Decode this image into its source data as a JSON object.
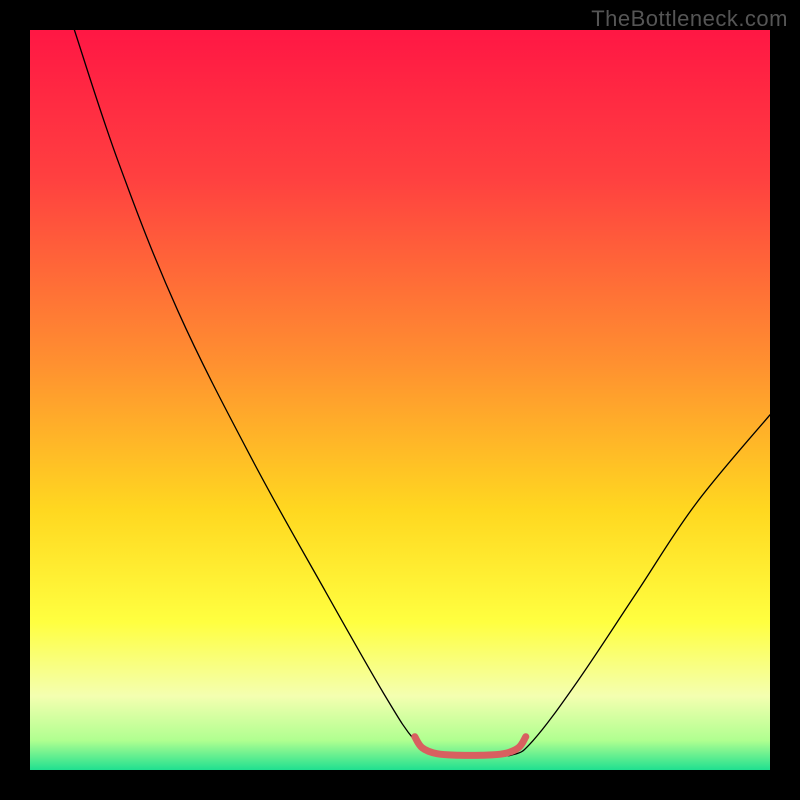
{
  "watermark": "TheBottleneck.com",
  "chart_data": {
    "type": "line",
    "title": "",
    "xlabel": "",
    "ylabel": "",
    "xlim": [
      0,
      100
    ],
    "ylim": [
      0,
      100
    ],
    "background_gradient": {
      "stops": [
        {
          "offset": 0.0,
          "color": "#ff1744"
        },
        {
          "offset": 0.2,
          "color": "#ff4040"
        },
        {
          "offset": 0.45,
          "color": "#ff9030"
        },
        {
          "offset": 0.65,
          "color": "#ffd820"
        },
        {
          "offset": 0.8,
          "color": "#ffff40"
        },
        {
          "offset": 0.9,
          "color": "#f4ffb0"
        },
        {
          "offset": 0.96,
          "color": "#b0ff90"
        },
        {
          "offset": 1.0,
          "color": "#20e090"
        }
      ]
    },
    "series": [
      {
        "name": "bottleneck-curve",
        "color": "#000000",
        "stroke_width": 1.3,
        "points": [
          {
            "x": 6,
            "y": 100
          },
          {
            "x": 12,
            "y": 82
          },
          {
            "x": 20,
            "y": 62
          },
          {
            "x": 30,
            "y": 42
          },
          {
            "x": 40,
            "y": 24
          },
          {
            "x": 48,
            "y": 10
          },
          {
            "x": 52,
            "y": 4
          },
          {
            "x": 55,
            "y": 2
          },
          {
            "x": 60,
            "y": 2
          },
          {
            "x": 65,
            "y": 2
          },
          {
            "x": 68,
            "y": 4
          },
          {
            "x": 74,
            "y": 12
          },
          {
            "x": 82,
            "y": 24
          },
          {
            "x": 90,
            "y": 36
          },
          {
            "x": 100,
            "y": 48
          }
        ]
      },
      {
        "name": "optimal-zone-marker",
        "color": "#d86060",
        "stroke_width": 7,
        "points": [
          {
            "x": 52,
            "y": 4.5
          },
          {
            "x": 53,
            "y": 3.0
          },
          {
            "x": 55,
            "y": 2.2
          },
          {
            "x": 58,
            "y": 2.0
          },
          {
            "x": 61,
            "y": 2.0
          },
          {
            "x": 64,
            "y": 2.2
          },
          {
            "x": 66,
            "y": 3.0
          },
          {
            "x": 67,
            "y": 4.5
          }
        ]
      }
    ]
  }
}
